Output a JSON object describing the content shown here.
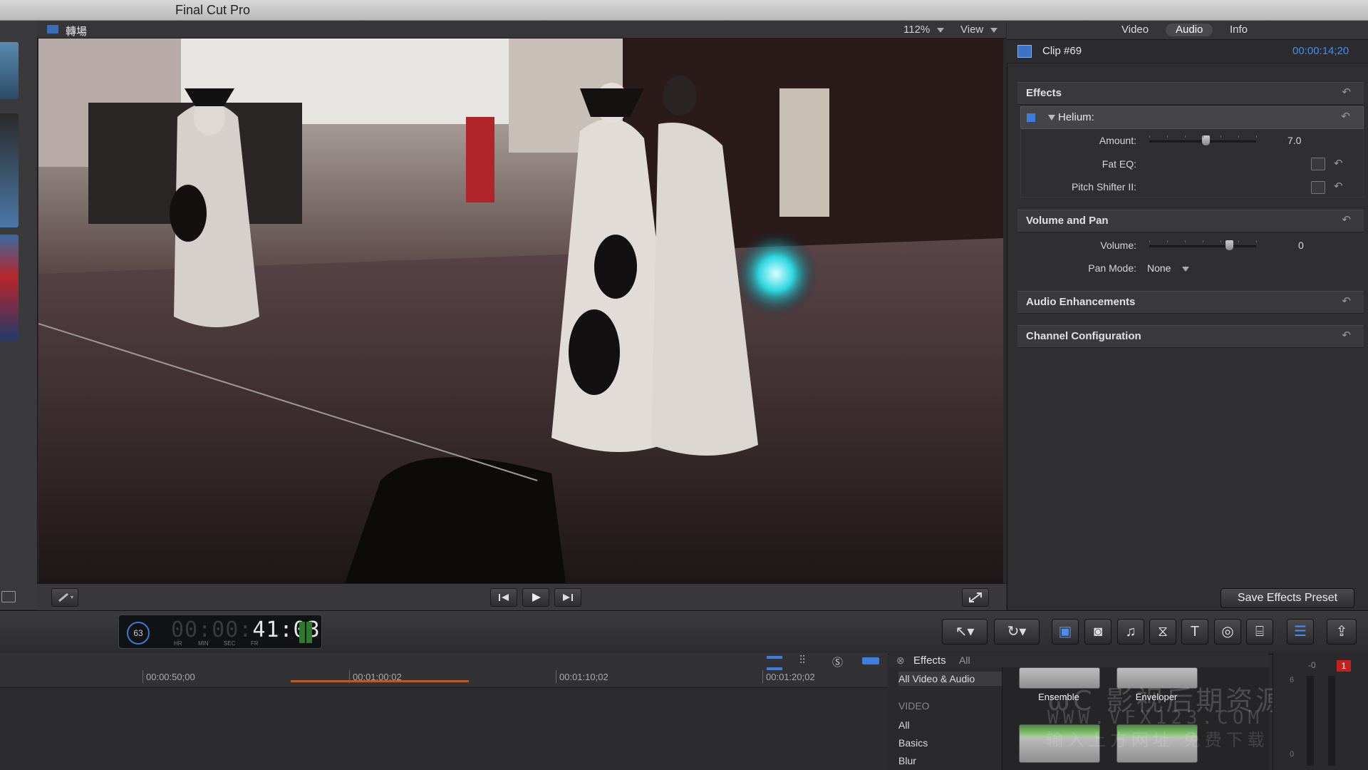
{
  "app": {
    "title": "Final Cut Pro"
  },
  "viewer": {
    "clip_name": "轉場",
    "zoom": "112%",
    "view_menu": "View"
  },
  "inspector": {
    "tabs": [
      {
        "label": "Video",
        "active": false
      },
      {
        "label": "Audio",
        "active": true
      },
      {
        "label": "Info",
        "active": false
      }
    ],
    "clip_title": "Clip #69",
    "clip_duration": "00:00:14;20",
    "sections": {
      "effects": {
        "label": "Effects",
        "plugin": {
          "label": "Helium:",
          "enabled": true,
          "params": [
            {
              "label": "Amount:",
              "value": "7.0",
              "slider_fraction": 0.55
            },
            {
              "label": "Fat EQ:"
            },
            {
              "label": "Pitch Shifter II:"
            }
          ]
        }
      },
      "volume_pan": {
        "label": "Volume and Pan",
        "volume_label": "Volume:",
        "volume_value": "0",
        "volume_fraction": 0.75,
        "pan_mode_label": "Pan Mode:",
        "pan_mode_value": "None"
      },
      "audio_enhancements": {
        "label": "Audio Enhancements"
      },
      "channel_configuration": {
        "label": "Channel Configuration"
      }
    },
    "save_preset_label": "Save Effects Preset"
  },
  "toolbar": {
    "timecode_percent": "63",
    "timecode_dim": "00:00:",
    "timecode_lit": "41:03",
    "timecode_units": [
      "HR",
      "MIN",
      "SEC",
      "FR"
    ]
  },
  "timeline": {
    "ruler": [
      "00:00:50;00",
      "00:01:00;02",
      "00:01:10;02",
      "00:01:20;02"
    ]
  },
  "effects_browser": {
    "title": "Effects",
    "filter": "All",
    "selected_category": "All Video & Audio",
    "video_section": "VIDEO",
    "video_items": [
      "All",
      "Basics",
      "Blur"
    ],
    "thumbnails": [
      "Ensemble",
      "Enveloper"
    ]
  },
  "meters": {
    "top_value": "-0",
    "peak": "1",
    "scale": [
      "6",
      "0"
    ]
  },
  "watermark": {
    "line1": "ωC 影视后期资源站",
    "line2": "WWW.VFX123.COM",
    "line3": "输入上方网址 免费下载"
  },
  "colors": {
    "accent_blue": "#3a78d6",
    "peak_red": "#c42020",
    "playrange_orange": "#b85a25"
  }
}
